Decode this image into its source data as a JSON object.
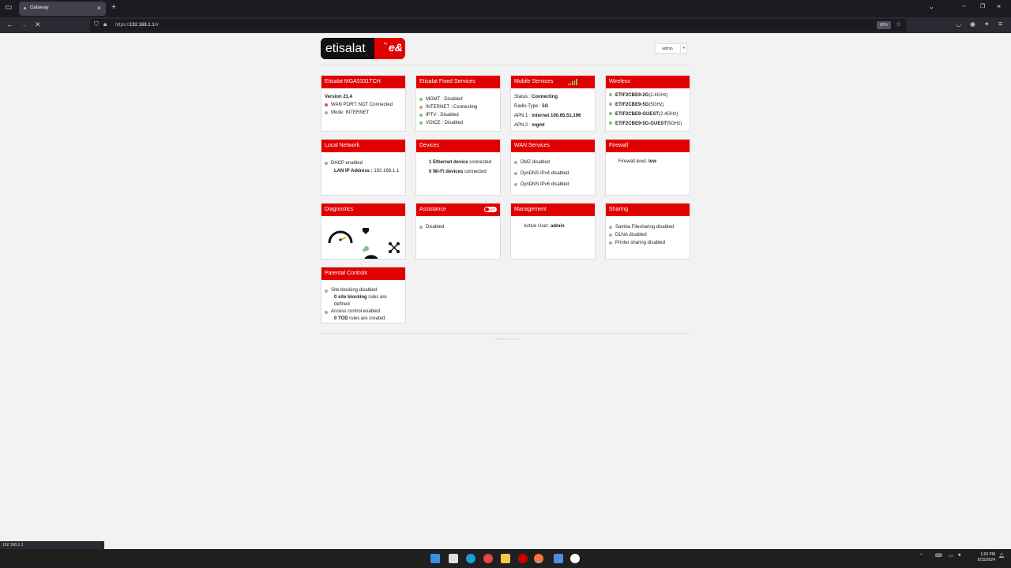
{
  "browser": {
    "tab_title": "Gateway",
    "url_prefix": "https://",
    "url_host": "192.168.1.1",
    "url_suffix": "/#",
    "zoom": "80%"
  },
  "header": {
    "logo_text": "etisalat",
    "logo_by": "by",
    "logo_brand": "e&",
    "user_select": "admin"
  },
  "cards": {
    "device": {
      "title": "Etisalat MGA5331TCH",
      "version": "Version 21.4",
      "rows": [
        "WAN PORT: NOT Connected",
        "Mode: INTERNET"
      ]
    },
    "fixed": {
      "title": "Etisalat Fixed Services",
      "rows": [
        "MGMT : Disabled",
        "INTERNET : Connecting",
        "IPTV : Disabled",
        "VOICE : Disabled"
      ]
    },
    "mobile": {
      "title": "Mobile Services",
      "status_label": "Status : ",
      "status_value": "Connecting",
      "radio_label": "Radio Type : ",
      "radio_value": "5G",
      "apn1_label": "APN 1 : ",
      "apn1_value": "internet 100.65.51.196",
      "apn2_label": "APN 2 : ",
      "apn2_value": "mgmt"
    },
    "wireless": {
      "title": "Wireless",
      "rows": [
        {
          "name": "ETIF2CBE9-2G",
          "band": "(2.4GHz)"
        },
        {
          "name": "ETIF2CBE9-5G",
          "band": "(5GHz)"
        },
        {
          "name": "ETIF2CBE9-GUEST",
          "band": "(2.4GHz)"
        },
        {
          "name": "ETIF2CBE9-5G-GUEST",
          "band": "(5GHz)"
        }
      ]
    },
    "local": {
      "title": "Local Network",
      "dhcp": "DHCP enabled",
      "lan_label": "LAN IP Address : ",
      "lan_value": "192.168.1.1"
    },
    "devices": {
      "title": "Devices",
      "eth_count": "1 Ethernet device",
      "eth_suffix": " connected",
      "wifi_count": "0 Wi-Fi devices",
      "wifi_suffix": " connected"
    },
    "wan": {
      "title": "WAN Services",
      "rows": [
        "DMZ disabled",
        "DynDNS IPv4 disabled",
        "DynDNS IPv6 disabled"
      ]
    },
    "firewall": {
      "title": "Firewall",
      "label": "Firewall level: ",
      "value": "low"
    },
    "diagnostics": {
      "title": "Diagnostics"
    },
    "assistance": {
      "title": "Assistance",
      "toggle_label": "OFF",
      "rows": [
        "Disabled"
      ]
    },
    "management": {
      "title": "Management",
      "label": "Active User: ",
      "value": "admin"
    },
    "sharing": {
      "title": "Sharing",
      "rows": [
        "Samba Filesharing disabled",
        "DLNA disabled",
        "Printer sharing disabled"
      ]
    },
    "parental": {
      "title": "Parental Controls",
      "site_blocking": "Site blocking disabled",
      "site_rules_count": "0 site blocking",
      "site_rules_suffix": " rules are",
      "site_rules_tail": "defined",
      "access": "Access control enabled",
      "tod_count": "0 TOD",
      "tod_suffix": " rules are created"
    }
  },
  "footer": "© Technicolor 2023",
  "status_url": "192.168.1.1",
  "taskbar": {
    "time": "1:50 PM",
    "date": "6/15/2024"
  },
  "colors": {
    "brand_red": "#e00000",
    "ok_green": "#7ec27e",
    "error_red": "#e05050",
    "pending_orange": "#e0a020"
  }
}
